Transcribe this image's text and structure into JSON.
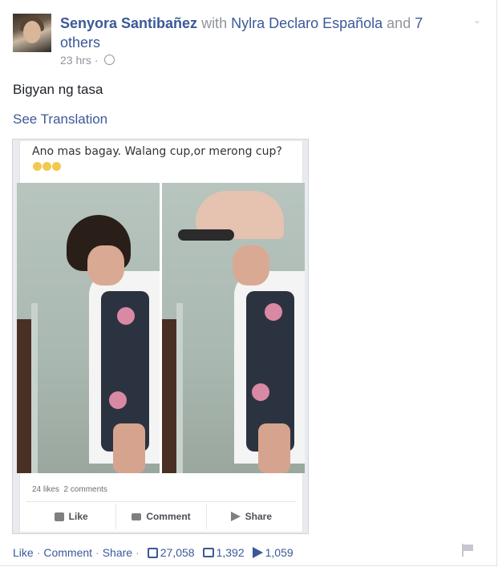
{
  "post": {
    "author": "Senyora Santibañez",
    "with_text": " with ",
    "tagged": "Nylra Declaro Española",
    "and_text": " and ",
    "others": "7 others",
    "time": "23 hrs",
    "text": "Bigyan ng tasa",
    "see_translation": "See Translation"
  },
  "embedded": {
    "caption": "Ano mas bagay. Walang cup,or merong cup?",
    "likes": "24 likes",
    "comments": "2 comments",
    "like_label": "Like",
    "comment_label": "Comment",
    "share_label": "Share"
  },
  "footer": {
    "like": "Like",
    "comment": "Comment",
    "share": "Share",
    "sep": "·",
    "like_count": "27,058",
    "comment_count": "1,392",
    "share_count": "1,059"
  },
  "colors": {
    "link": "#3b5998",
    "muted": "#90949c",
    "text": "#1d2129"
  },
  "icons": [
    "globe-icon",
    "chevron-down-icon",
    "thumbs-up-icon",
    "comment-icon",
    "share-icon",
    "flag-icon"
  ]
}
